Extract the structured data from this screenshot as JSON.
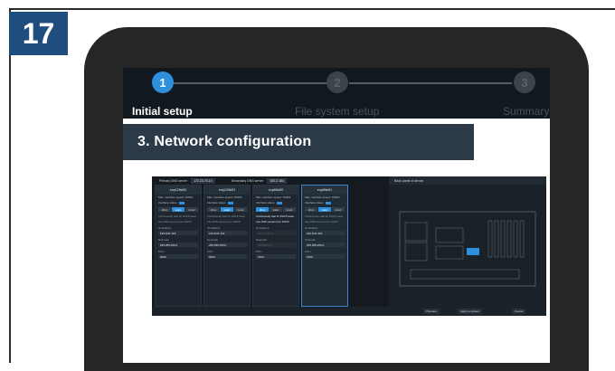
{
  "step_number": "17",
  "wizard": {
    "steps": [
      {
        "number": "1",
        "label": "Initial setup",
        "active": true
      },
      {
        "number": "2",
        "label": "File system setup",
        "active": false
      },
      {
        "number": "3",
        "label": "Summary",
        "active": false
      }
    ]
  },
  "banner_title": "3.   Network configuration",
  "app": {
    "dns": {
      "primary_label": "Primary DNS server",
      "primary_value": "172.23.75.10",
      "secondary_label": "Secondary DNS server",
      "secondary_value": "100.2.164"
    },
    "panels": [
      {
        "name": "enp129s0f0",
        "speed": "Max. interface speed: 10Gbit",
        "status_label": "Interface status",
        "modes": [
          "dhcp",
          "static",
          "bond"
        ],
        "check1": "Continuously wait for DHCP lease",
        "check2": "Use DNS servers from DHCP",
        "ip_label": "IP address",
        "ip": "192.8.61.119",
        "netmask_label": "Netmask",
        "netmask": "255.255.255.0",
        "mtu_label": "MTU",
        "mtu": "9000"
      },
      {
        "name": "enp129s0f1",
        "speed": "Max. interface speed: 10Gbit",
        "status_label": "Interface status",
        "modes": [
          "dhcp",
          "static",
          "bond"
        ],
        "check1": "Continuously wait for DHCP lease",
        "check2": "Use DNS servers from DHCP",
        "ip_label": "IP address",
        "ip": "192.8.61.119",
        "netmask_label": "Netmask",
        "netmask": "255.255.255.0",
        "mtu_label": "MTU",
        "mtu": "9000"
      },
      {
        "name": "enp65s0f0",
        "speed": "Max. interface speed: 10Gbit",
        "status_label": "Interface status",
        "modes": [
          "dhcp",
          "static",
          "bond"
        ],
        "check1": "Continuously wait for DHCP lease",
        "check2": "Use DNS servers from DHCP",
        "ip_label": "IP address",
        "ip": "172.23.75.10",
        "netmask_label": "Netmask",
        "netmask": "255.255.0.0",
        "mtu_label": "MTU",
        "mtu": "1500"
      },
      {
        "name": "enp65s0f1",
        "speed": "Max. interface speed: 10Gbit",
        "status_label": "Interface status",
        "modes": [
          "dhcp",
          "static",
          "bond"
        ],
        "check1": "Continuously wait for DHCP lease",
        "check2": "Use DNS servers from DHCP",
        "ip_label": "IP address",
        "ip": "192.8.61.119",
        "netmask_label": "Netmask",
        "netmask": "255.255.255.0",
        "mtu_label": "MTU",
        "mtu": "1500"
      }
    ],
    "status_value": "ON",
    "right_header": "Back panel of device",
    "footer": {
      "previous": "Previous",
      "apply": "Apply to system",
      "cancel": "Cancel"
    }
  },
  "colors": {
    "badge": "#1f4e7e",
    "accent": "#2e8fdc",
    "device": "#262626"
  }
}
